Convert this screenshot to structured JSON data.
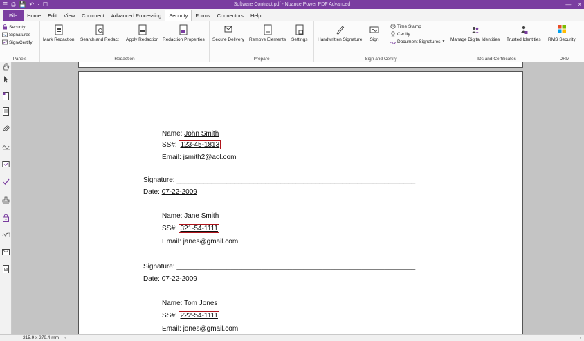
{
  "window": {
    "title": "Software Contract.pdf - Nuance Power PDF Advanced",
    "quick_access": [
      "☰",
      "⎙",
      "💾",
      "↶",
      "·",
      "☐"
    ],
    "controls": [
      "—",
      "×"
    ]
  },
  "tabs": [
    "File",
    "Home",
    "Edit",
    "View",
    "Comment",
    "Advanced Processing",
    "Security",
    "Forms",
    "Connectors",
    "Help"
  ],
  "active_tab": "Security",
  "ribbon": {
    "panels": {
      "label": "Panels",
      "items": [
        "Security",
        "Signatures",
        "Sign/Certify"
      ]
    },
    "redaction": {
      "label": "Redaction",
      "buttons": [
        "Mark Redaction",
        "Search and Redact",
        "Apply Redaction",
        "Redaction Properties"
      ]
    },
    "prepare": {
      "label": "Prepare",
      "buttons": [
        "Secure Delivery",
        "Remove Elements",
        "Settings"
      ]
    },
    "sign_certify": {
      "label": "Sign and Certify",
      "buttons": [
        "Handwritten Signature",
        "Sign"
      ],
      "small": [
        "Time Stamp",
        "Certify",
        "Document Signatures"
      ]
    },
    "ids": {
      "label": "IDs and Certificates",
      "buttons": [
        "Manage Digital Identities",
        "Trusted Identities"
      ]
    },
    "drm": {
      "label": "DRM",
      "buttons": [
        "RMS Security"
      ]
    }
  },
  "document": {
    "records": [
      {
        "name_label": "Name:",
        "name": "John Smith",
        "ss_label": "SS#:",
        "ss": "123-45-1813",
        "email_label": "Email:",
        "email": "jsmith2@aol.com",
        "email_underlined": true
      },
      {
        "name_label": "Name:",
        "name": "Jane Smith",
        "ss_label": "SS#:",
        "ss": "321-54-1111",
        "email_label": "Email:",
        "email": "janes@gmail.com",
        "email_underlined": false
      },
      {
        "name_label": "Name:",
        "name": "Tom Jones",
        "ss_label": "SS#:",
        "ss": "222-54-1111",
        "email_label": "Email:",
        "email": "jones@gmail.com",
        "email_underlined": false
      }
    ],
    "signature_label": "Signature:",
    "signature_line": "______________________________________________________________",
    "date_label": "Date:",
    "date": "07-22-2009"
  },
  "status": {
    "page_size": "215.9 x 279.4 mm",
    "left_arrow": "‹",
    "right_arrow": "›"
  },
  "colors": {
    "accent": "#7a3da0",
    "redaction_box": "#b0141b"
  }
}
